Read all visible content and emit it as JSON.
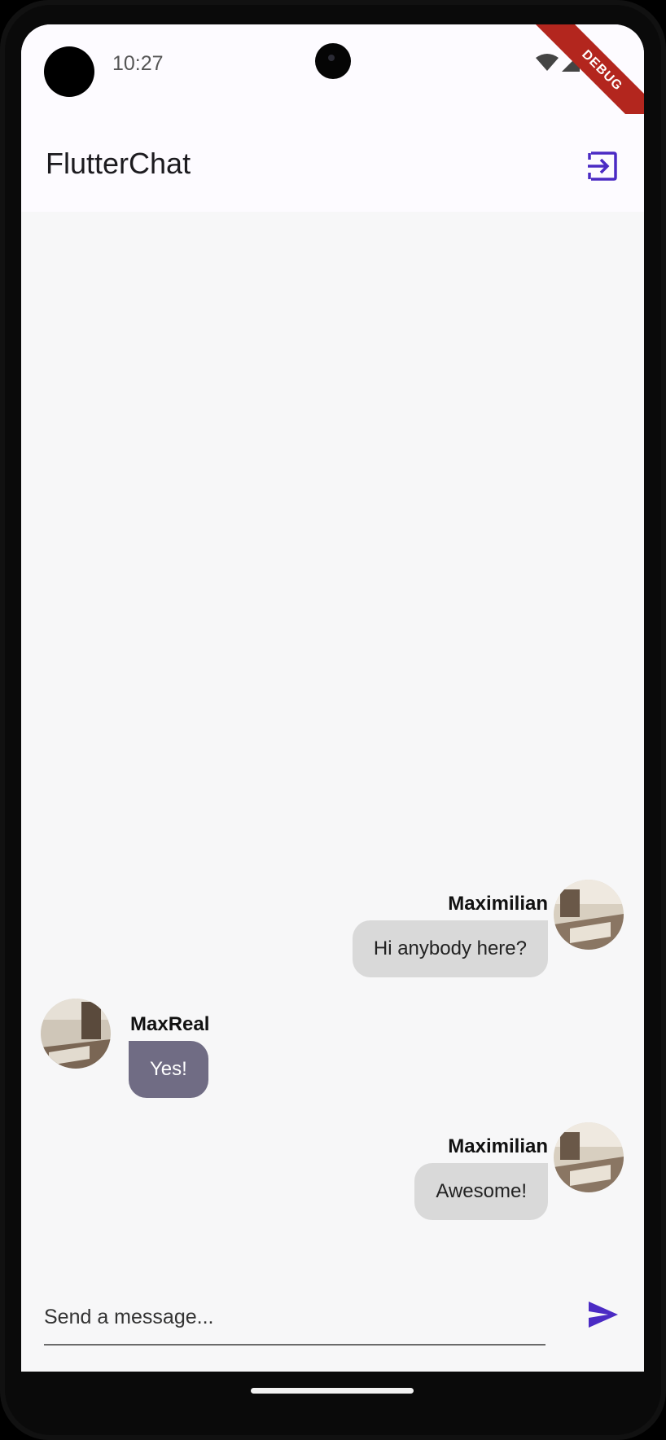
{
  "status_bar": {
    "time": "10:27"
  },
  "debug_banner": "DEBUG",
  "app_bar": {
    "title": "FlutterChat",
    "logout_icon": "logout-icon"
  },
  "messages": [
    {
      "sender": "Maximilian",
      "text": "Hi anybody here?",
      "is_me": true
    },
    {
      "sender": "MaxReal",
      "text": "Yes!",
      "is_me": false
    },
    {
      "sender": "Maximilian",
      "text": "Awesome!",
      "is_me": true
    }
  ],
  "composer": {
    "placeholder": "Send a message...",
    "value": "",
    "send_icon": "send-icon"
  },
  "colors": {
    "accent": "#4b2bc4",
    "my_bubble": "#d9d9d9",
    "other_bubble": "#706c84",
    "debug_banner": "#b3261e"
  }
}
